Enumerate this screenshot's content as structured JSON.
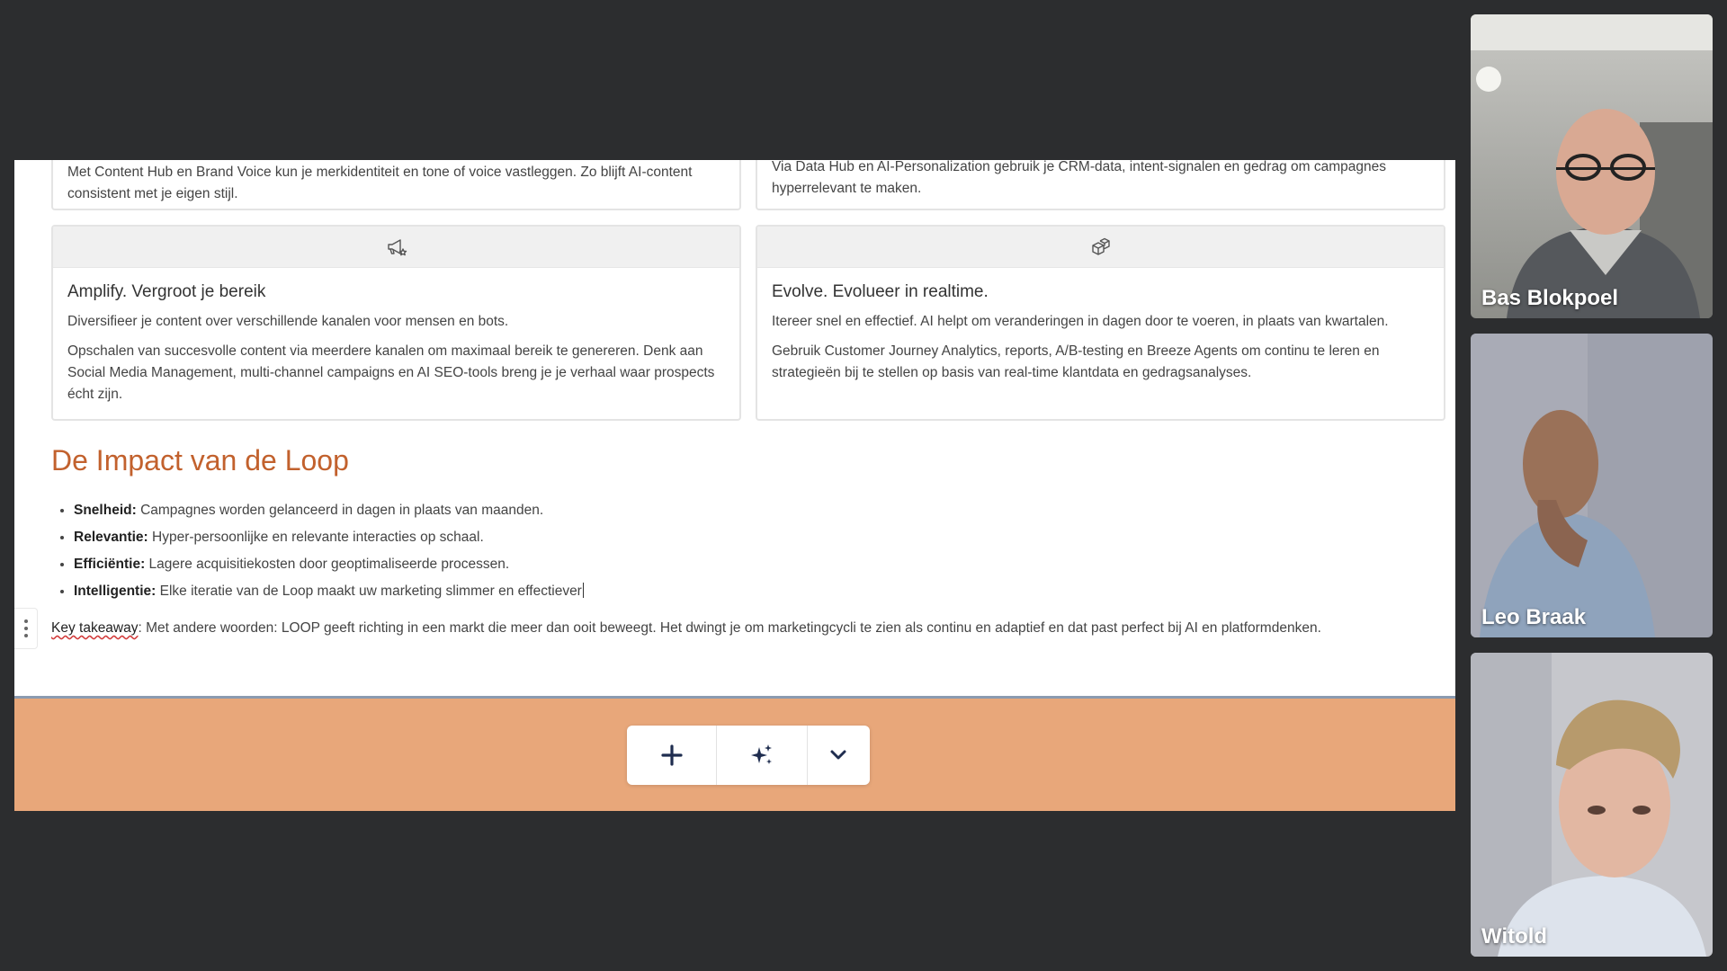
{
  "cards": [
    {
      "text": "Met Content Hub en Brand Voice kun je merkidentiteit en tone of voice vastleggen. Zo blijft AI-content consistent met je eigen stijl."
    },
    {
      "text": "Via Data Hub en AI-Personalization gebruik je CRM-data, intent-signalen en gedrag om campagnes hyperrelevant te maken."
    },
    {
      "icon": "megaphone-star-icon",
      "title": "Amplify. Vergroot je bereik",
      "p1": "Diversifieer je content over verschillende kanalen voor mensen en bots.",
      "p2": "Opschalen van succesvolle content via meerdere kanalen om maximaal bereik te genereren. Denk aan Social Media Management, multi-channel campaigns en AI SEO-tools breng je je verhaal waar prospects écht zijn."
    },
    {
      "icon": "cubes-icon",
      "title": "Evolve. Evolueer in realtime.",
      "p1": "Itereer snel en effectief. AI helpt om veranderingen in dagen door te voeren, in plaats van kwartalen.",
      "p2": "Gebruik Customer Journey Analytics, reports, A/B-testing en Breeze Agents om continu te leren en strategieën bij te stellen op basis van real-time klantdata en gedragsanalyses."
    }
  ],
  "section_title": "De Impact van de Loop",
  "bullets": [
    {
      "label": "Snelheid:",
      "text": "Campagnes worden gelanceerd in dagen in plaats van maanden."
    },
    {
      "label": "Relevantie:",
      "text": "Hyper-persoonlijke en relevante interacties op schaal."
    },
    {
      "label": "Efficiëntie:",
      "text": "Lagere acquisitiekosten door geoptimaliseerde processen."
    },
    {
      "label": "Intelligentie:",
      "text": "Elke iteratie van de Loop maakt uw marketing slimmer en effectiever"
    }
  ],
  "takeaway": {
    "label": "Key takeaway",
    "text": ": Met andere woorden: LOOP geeft richting in een markt die meer dan ooit beweegt. Het dwingt je om marketingcycli te zien als continu en adaptief en dat past perfect bij AI en platformdenken."
  },
  "toolbar": {
    "add_icon": "plus-icon",
    "ai_icon": "sparkles-icon",
    "more_icon": "chevron-down-icon"
  },
  "participants": [
    {
      "name": "Bas Blokpoel"
    },
    {
      "name": "Leo Braak"
    },
    {
      "name": "Witold"
    }
  ],
  "colors": {
    "heading_accent": "#c2612d",
    "band": "#e8a77a",
    "toolbar_icon": "#1f2d4f",
    "app_background": "#2c2d2f"
  }
}
